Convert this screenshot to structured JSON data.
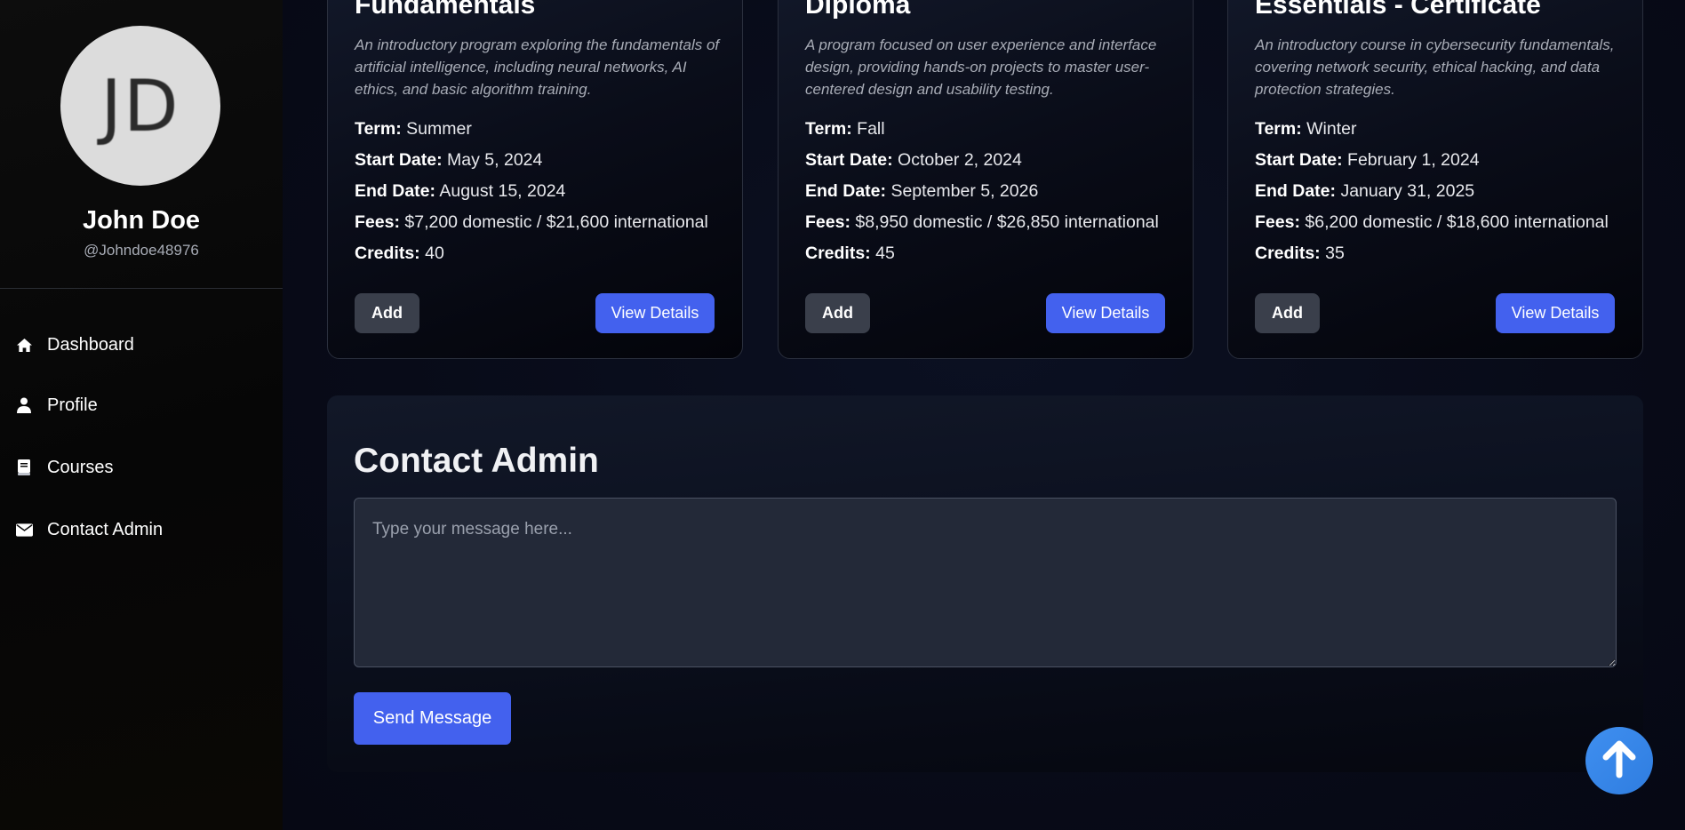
{
  "profile": {
    "initials": "JD",
    "name": "John Doe",
    "handle": "@Johndoe48976"
  },
  "nav": {
    "items": [
      {
        "label": "Dashboard",
        "icon": "home-icon"
      },
      {
        "label": "Profile",
        "icon": "user-icon"
      },
      {
        "label": "Courses",
        "icon": "book-icon"
      },
      {
        "label": "Contact Admin",
        "icon": "envelope-icon"
      }
    ]
  },
  "courses": [
    {
      "title": "Fundamentals",
      "description": "An introductory program exploring the fundamentals of artificial intelligence, including neural networks, AI ethics, and basic algorithm training.",
      "term_label": "Term:",
      "term": "Summer",
      "start_label": "Start Date:",
      "start": "May 5, 2024",
      "end_label": "End Date:",
      "end": "August 15, 2024",
      "fees_label": "Fees:",
      "fees": "$7,200 domestic / $21,600 international",
      "credits_label": "Credits:",
      "credits": "40",
      "add_label": "Add",
      "details_label": "View Details"
    },
    {
      "title": "Diploma",
      "description": "A program focused on user experience and interface design, providing hands-on projects to master user-centered design and usability testing.",
      "term_label": "Term:",
      "term": "Fall",
      "start_label": "Start Date:",
      "start": "October 2, 2024",
      "end_label": "End Date:",
      "end": "September 5, 2026",
      "fees_label": "Fees:",
      "fees": "$8,950 domestic / $26,850 international",
      "credits_label": "Credits:",
      "credits": "45",
      "add_label": "Add",
      "details_label": "View Details"
    },
    {
      "title": "Essentials - Certificate",
      "description": "An introductory course in cybersecurity fundamentals, covering network security, ethical hacking, and data protection strategies.",
      "term_label": "Term:",
      "term": "Winter",
      "start_label": "Start Date:",
      "start": "February 1, 2024",
      "end_label": "End Date:",
      "end": "January 31, 2025",
      "fees_label": "Fees:",
      "fees": "$6,200 domestic / $18,600 international",
      "credits_label": "Credits:",
      "credits": "35",
      "add_label": "Add",
      "details_label": "View Details"
    }
  ],
  "contact": {
    "title": "Contact Admin",
    "placeholder": "Type your message here...",
    "send_label": "Send Message"
  },
  "scroll_top": {
    "icon": "arrow-up-icon"
  },
  "colors": {
    "accent": "#4361ee",
    "scroll_button": "#3f8ff0",
    "secondary_button": "#3a3f4b"
  }
}
